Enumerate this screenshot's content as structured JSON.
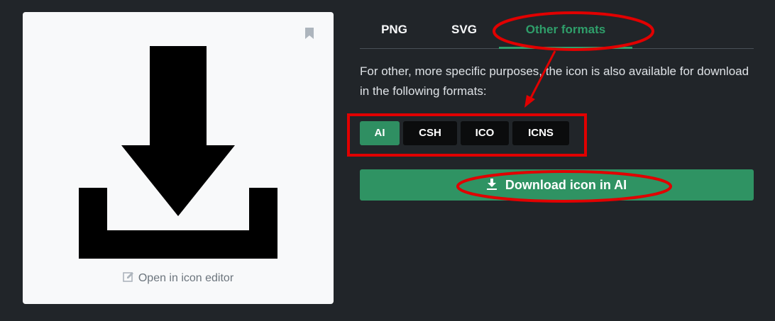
{
  "preview": {
    "editor_link_label": "Open in icon editor",
    "icon_name": "download-tray-icon"
  },
  "tabs": [
    {
      "label": "PNG",
      "active": false
    },
    {
      "label": "SVG",
      "active": false
    },
    {
      "label": "Other formats",
      "active": true
    }
  ],
  "description": "For other, more specific purposes, the icon is also available for download in the following formats:",
  "formats": [
    {
      "label": "AI",
      "selected": true
    },
    {
      "label": "CSH",
      "selected": false
    },
    {
      "label": "ICO",
      "selected": false
    },
    {
      "label": "ICNS",
      "selected": false
    }
  ],
  "download_button": {
    "label": "Download icon in AI"
  },
  "colors": {
    "background": "#212529",
    "accent": "#2f9363",
    "annotation": "#e10000"
  }
}
